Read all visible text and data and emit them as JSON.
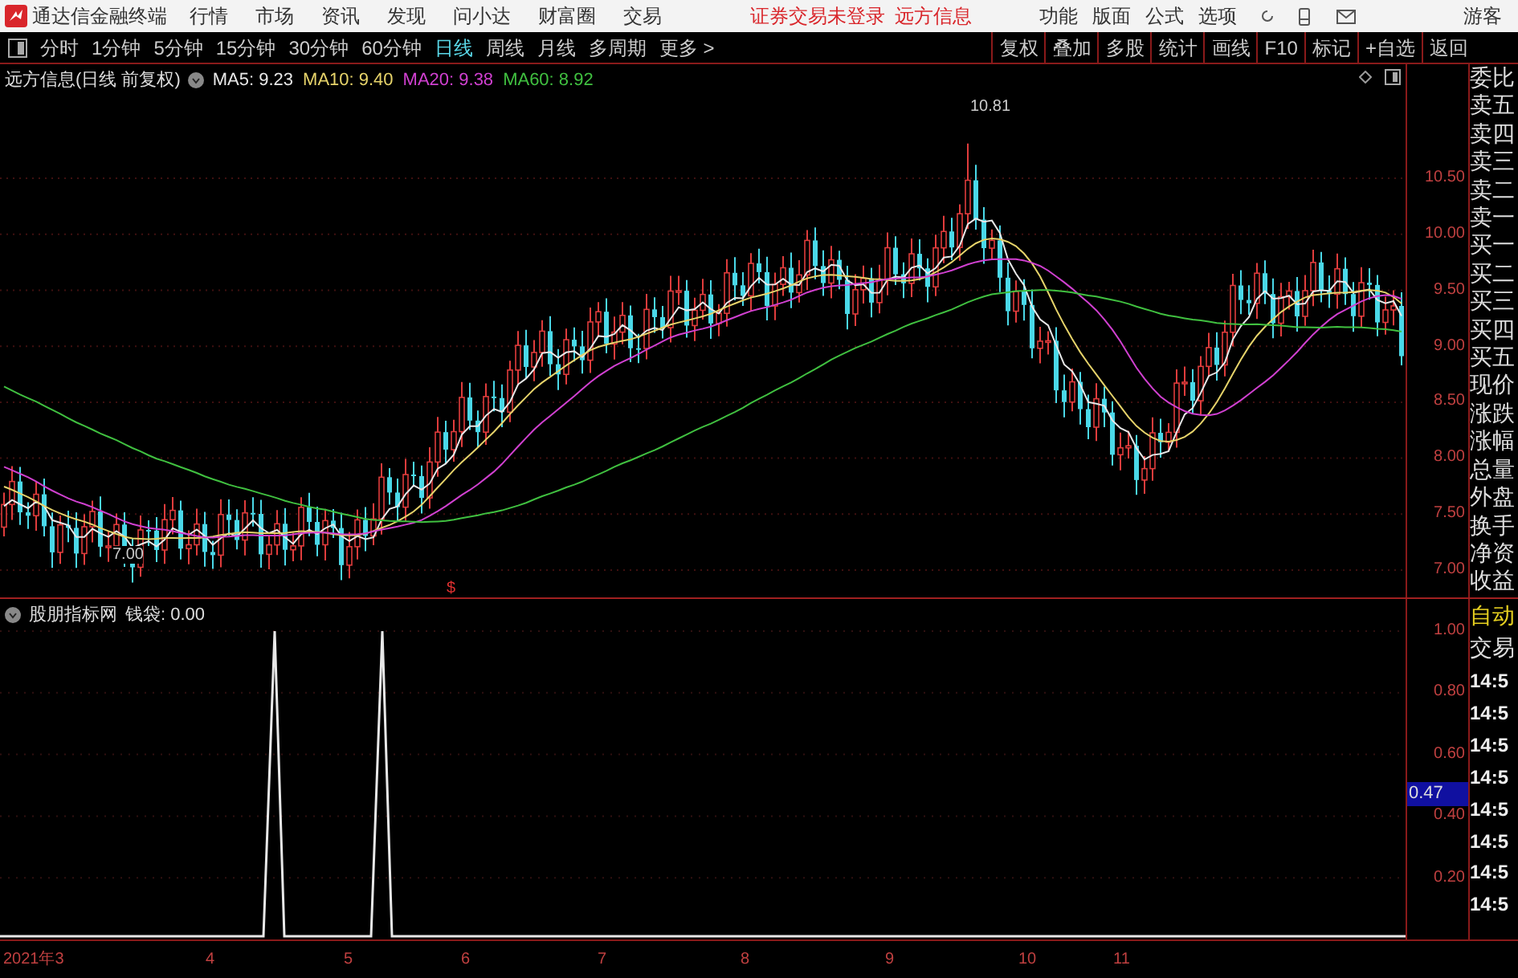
{
  "app": {
    "title": "通达信金融终端"
  },
  "menu": [
    "行情",
    "市场",
    "资讯",
    "发现",
    "问小达",
    "财富圈",
    "交易"
  ],
  "notices": [
    "证券交易未登录",
    "远方信息"
  ],
  "right_menu": [
    "功能",
    "版面",
    "公式",
    "选项"
  ],
  "user": "游客",
  "period_tabs": [
    {
      "label": "分时",
      "selected": false
    },
    {
      "label": "1分钟",
      "selected": false
    },
    {
      "label": "5分钟",
      "selected": false
    },
    {
      "label": "15分钟",
      "selected": false
    },
    {
      "label": "30分钟",
      "selected": false
    },
    {
      "label": "60分钟",
      "selected": false
    },
    {
      "label": "日线",
      "selected": true
    },
    {
      "label": "周线",
      "selected": false
    },
    {
      "label": "月线",
      "selected": false
    },
    {
      "label": "多周期",
      "selected": false
    },
    {
      "label": "更多 >",
      "selected": false
    }
  ],
  "tool_buttons": [
    "复权",
    "叠加",
    "多股",
    "统计",
    "画线",
    "F10",
    "标记",
    "+自选",
    "返回"
  ],
  "price_chart": {
    "title": "远方信息(日线 前复权)",
    "moving_averages": [
      {
        "label": "MA5: 9.23",
        "color": "#e8e8e8"
      },
      {
        "label": "MA10: 9.40",
        "color": "#e6d36a"
      },
      {
        "label": "MA20: 9.38",
        "color": "#d040d0"
      },
      {
        "label": "MA60: 8.92",
        "color": "#40c040"
      }
    ],
    "high_label": "10.81",
    "low_label": "7.00",
    "marker": "$",
    "axis": [
      "10.50",
      "10.00",
      "9.50",
      "9.00",
      "8.50",
      "8.00",
      "7.50",
      "7.00"
    ]
  },
  "quote_labels": [
    "委比",
    "卖五",
    "卖四",
    "卖三",
    "卖二",
    "卖一",
    "买一",
    "买二",
    "买三",
    "买四",
    "买五",
    "现价",
    "涨跌",
    "涨幅",
    "总量",
    "外盘",
    "换手",
    "净资",
    "收益"
  ],
  "trade_header": [
    {
      "label": "自动",
      "highlighted": true
    },
    {
      "label": "交易",
      "highlighted": false
    }
  ],
  "trade_times": [
    "14:5",
    "14:5",
    "14:5",
    "14:5",
    "14:5",
    "14:5",
    "14:5",
    "14:5"
  ],
  "indicator": {
    "title": "股朋指标网",
    "reading": "钱袋: 0.00",
    "axis": [
      "1.00",
      "0.80",
      "0.60",
      "0.40",
      "0.20"
    ],
    "current_value": "0.47"
  },
  "dates": [
    "2021年3",
    "4",
    "5",
    "6",
    "7",
    "8",
    "9",
    "10",
    "11"
  ]
}
